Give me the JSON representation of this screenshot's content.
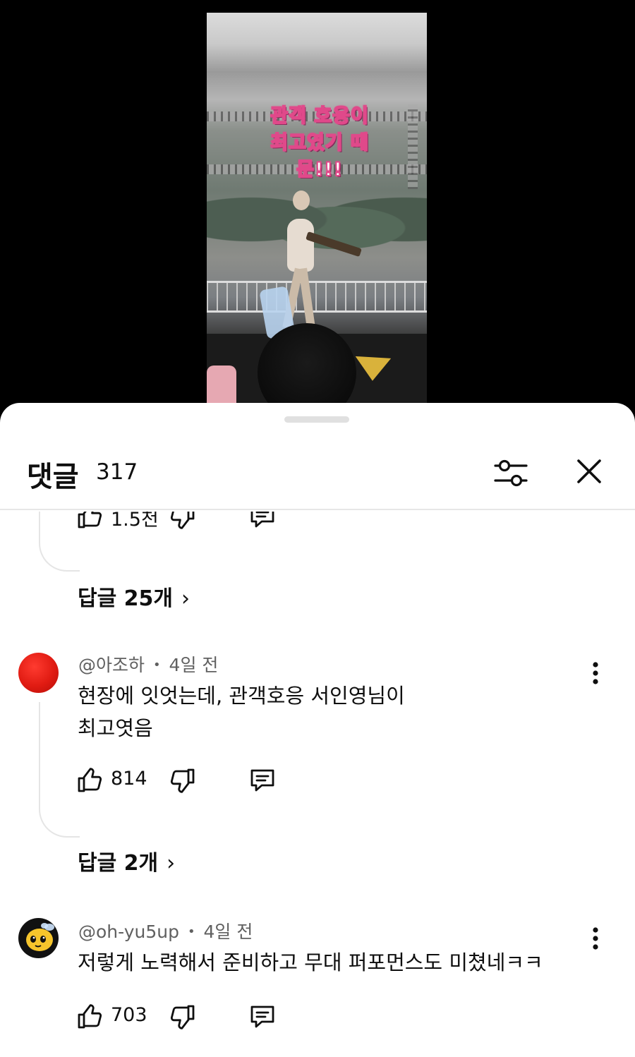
{
  "video": {
    "caption_line1": "관객 호응이",
    "caption_line2": "최고였기 때문!!!"
  },
  "sheet": {
    "title": "댓글",
    "count": "317",
    "filter_icon": "tune-icon",
    "close_icon": "close-icon"
  },
  "comments": [
    {
      "partial": true,
      "likes": "1.5천",
      "replies_label": "답글 25개",
      "replies_chevron": "›"
    },
    {
      "author": "@아조하",
      "separator": "•",
      "time": "4일 전",
      "text_line1": "현장에 잇엇는데, 관객호응 서인영님이",
      "text_line2": "최고엿음",
      "likes": "814",
      "replies_label": "답글 2개",
      "replies_chevron": "›",
      "avatar_color": "#e01b12"
    },
    {
      "author": "@oh-yu5up",
      "separator": "•",
      "time": "4일 전",
      "text_line1": "저렇게 노력해서 준비하고 무대 퍼포먼스도 미쳤네ㅋㅋ",
      "likes": "703",
      "avatar_icon": "bee-avatar-icon"
    }
  ],
  "icons": {
    "like": "thumbs-up-icon",
    "dislike": "thumbs-down-icon",
    "reply": "comment-icon",
    "more": "more-vert-icon"
  }
}
